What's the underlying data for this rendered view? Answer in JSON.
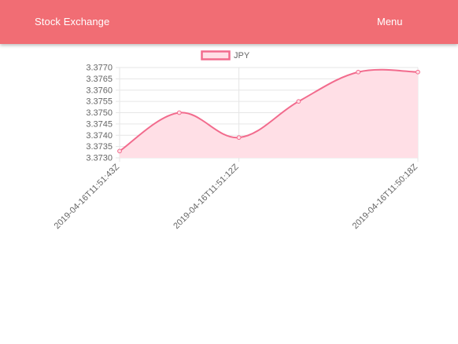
{
  "header": {
    "title": "Stock Exchange",
    "menu_label": "Menu"
  },
  "colors": {
    "appbar": "#f16d74",
    "line": "#f26b8d",
    "fill": "#ffdfe6",
    "grid": "#e6e6e6",
    "text": "#666666"
  },
  "chart_data": {
    "type": "line",
    "legend_position": "top",
    "grid": true,
    "x": [
      "2019-04-16T11:51:43Z",
      "",
      "2019-04-16T11:51:12Z",
      "",
      "",
      "2019-04-16T11:50:18Z"
    ],
    "x_tick_labels": [
      "2019-04-16T11:51:43Z",
      "2019-04-16T11:51:12Z",
      "2019-04-16T11:50:18Z"
    ],
    "series": [
      {
        "name": "JPY",
        "values": [
          3.3733,
          3.375,
          3.3739,
          3.3755,
          3.3768,
          3.3768
        ]
      }
    ],
    "yticks": [
      "3.3770",
      "3.3765",
      "3.3760",
      "3.3755",
      "3.3750",
      "3.3745",
      "3.3740",
      "3.3735",
      "3.3730"
    ],
    "ylim": [
      3.373,
      3.377
    ]
  }
}
